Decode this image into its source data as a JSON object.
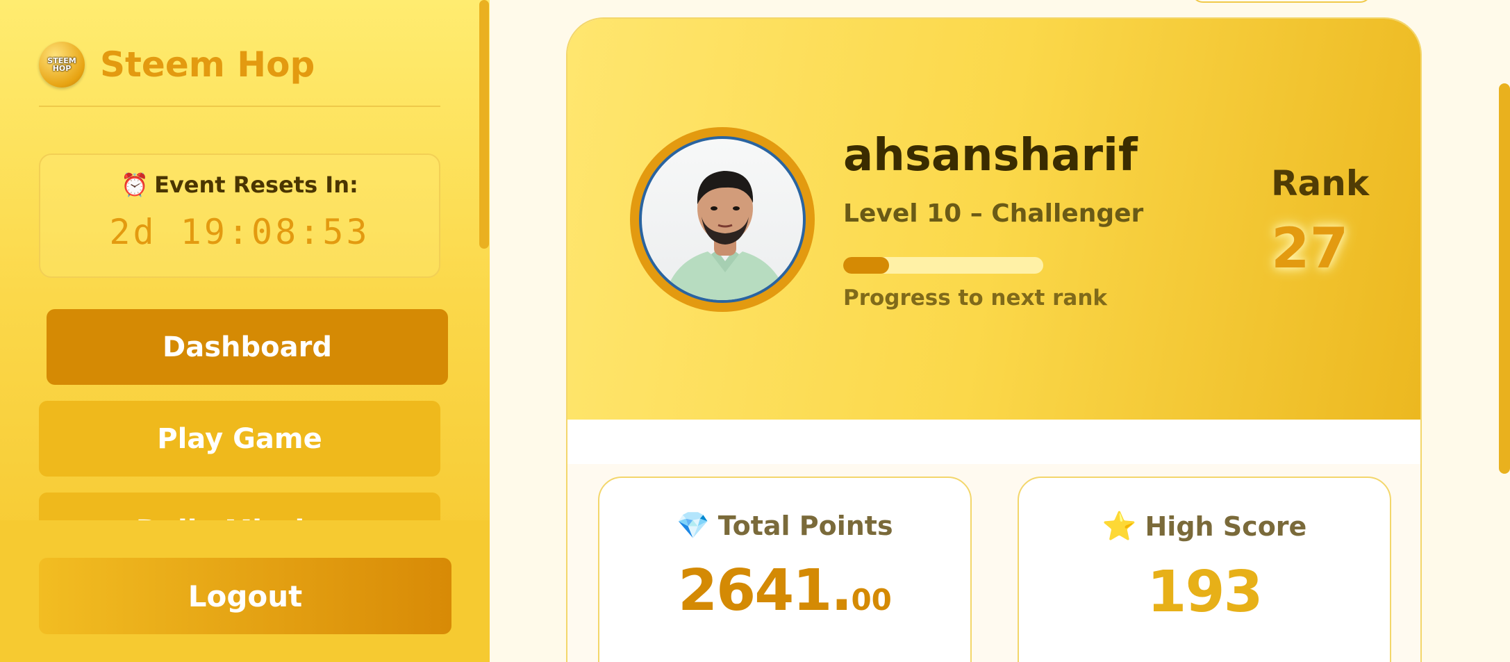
{
  "brand": {
    "name": "Steem Hop",
    "logo_text_1": "STEEM",
    "logo_text_2": "HOP"
  },
  "timer": {
    "icon": "alarm-clock-icon",
    "label": "Event Resets In:",
    "value": "2d 19:08:53"
  },
  "nav": {
    "dashboard": "Dashboard",
    "play_game": "Play Game",
    "third_item_partial": "Daily Mission"
  },
  "logout": "Logout",
  "profile": {
    "username": "ahsansharif",
    "level": "Level 10 – Challenger",
    "progress_fraction": 0.23,
    "progress_label": "Progress to next rank",
    "rank_label": "Rank",
    "rank_value": "27"
  },
  "stats": {
    "total_points": {
      "icon": "gem-icon",
      "label": "Total Points",
      "value_int": "2641.",
      "value_dec": "00"
    },
    "high_score": {
      "icon": "star-icon",
      "label": "High Score",
      "value": "193"
    }
  },
  "colors": {
    "accent": "#e39a10",
    "primary_button": "#d58a04",
    "secondary_button": "#efb91c",
    "sidebar_bg": "#fbd84a",
    "page_bg": "#fffaea"
  }
}
